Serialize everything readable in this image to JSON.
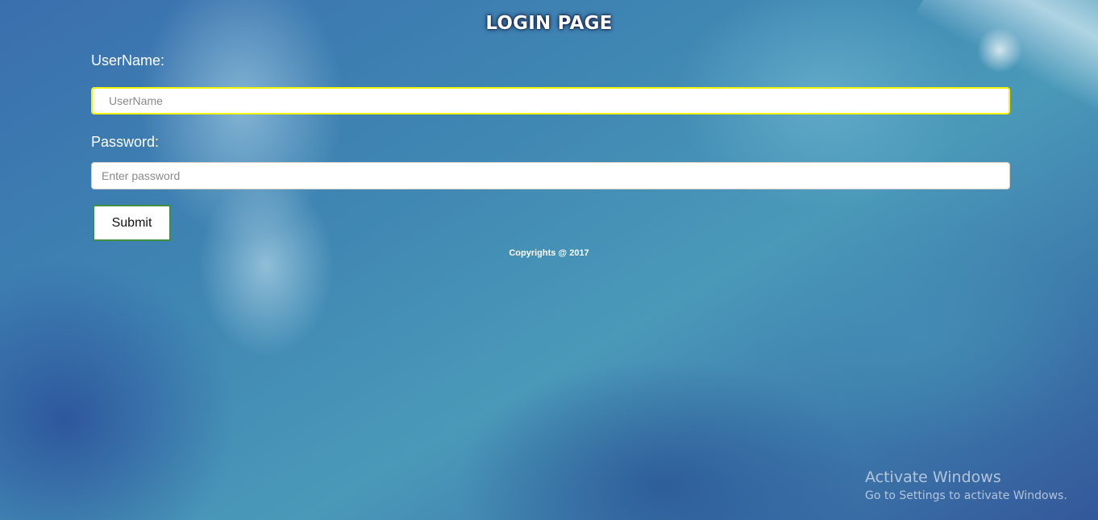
{
  "page": {
    "title": "LOGIN PAGE"
  },
  "form": {
    "username_label": "UserName:",
    "username_placeholder": "UserName",
    "username_value": "",
    "password_label": "Password:",
    "password_placeholder": "Enter password",
    "password_value": "",
    "submit_label": "Submit"
  },
  "footer": {
    "copyright": "Copyrights @ 2017"
  },
  "os_watermark": {
    "title": "Activate Windows",
    "subtitle": "Go to Settings to activate Windows."
  },
  "colors": {
    "focused_input_border": "#f2f20a",
    "submit_border": "#3f8f3f",
    "text_on_background": "#ffffff"
  }
}
